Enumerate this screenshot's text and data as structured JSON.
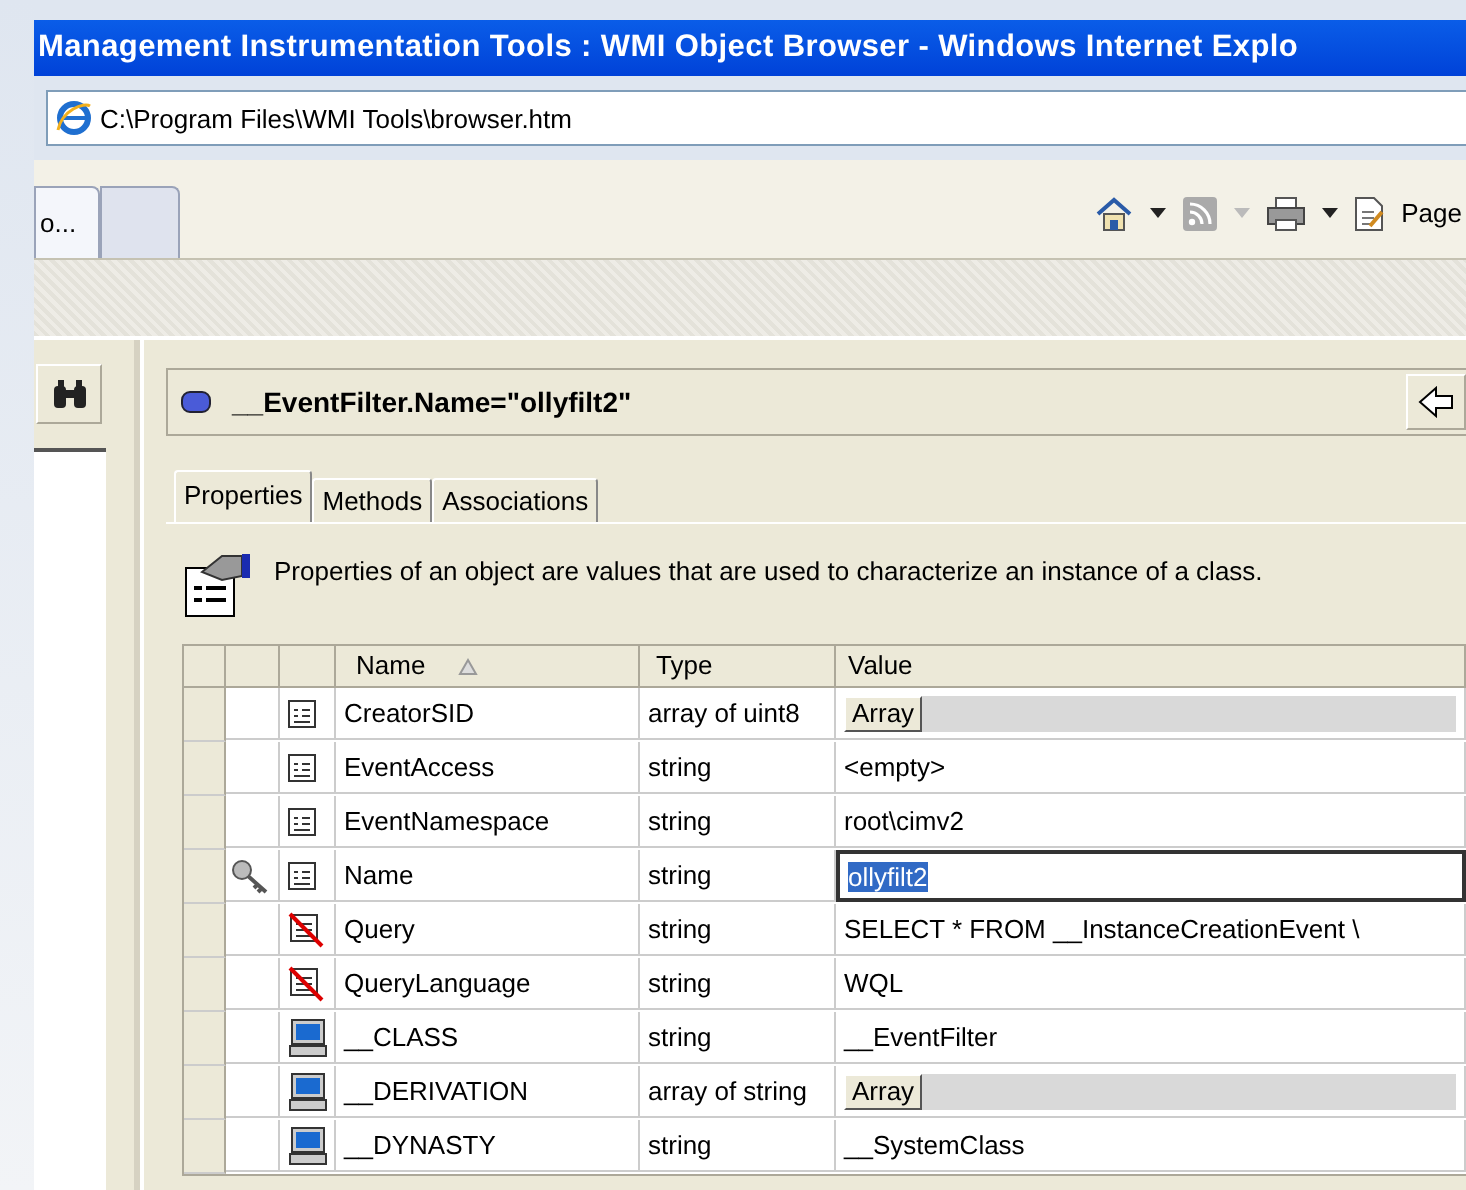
{
  "window": {
    "title": "Management Instrumentation Tools : WMI Object Browser - Windows Internet Explo"
  },
  "address_bar": {
    "value": "C:\\Program Files\\WMI Tools\\browser.htm"
  },
  "browser_tabs": [
    {
      "label": "o...",
      "selected": true
    },
    {
      "selected": false
    }
  ],
  "toolbar": {
    "page_label": "Page"
  },
  "object_path": "__EventFilter.Name=\"ollyfilt2\"",
  "tabs": [
    {
      "label": "Properties",
      "selected": true
    },
    {
      "label": "Methods",
      "selected": false
    },
    {
      "label": "Associations",
      "selected": false
    }
  ],
  "description": "Properties of an object are values that are used to characterize an instance of a class.",
  "table": {
    "columns": [
      "Name",
      "Type",
      "Value"
    ],
    "rows": [
      {
        "kind": "property",
        "key": false,
        "name": "CreatorSID",
        "type": "array of uint8",
        "value": {
          "kind": "array",
          "text": "Array"
        },
        "editing": false
      },
      {
        "kind": "property",
        "key": false,
        "name": "EventAccess",
        "type": "string",
        "value": {
          "kind": "text",
          "text": "<empty>"
        },
        "editing": false
      },
      {
        "kind": "property",
        "key": false,
        "name": "EventNamespace",
        "type": "string",
        "value": {
          "kind": "text",
          "text": "root\\cimv2"
        },
        "editing": false
      },
      {
        "kind": "property",
        "key": true,
        "name": "Name",
        "type": "string",
        "value": {
          "kind": "text",
          "text": "ollyfilt2"
        },
        "editing": true
      },
      {
        "kind": "restricted",
        "key": false,
        "name": "Query",
        "type": "string",
        "value": {
          "kind": "text",
          "text": "SELECT * FROM __InstanceCreationEvent \\"
        },
        "editing": false
      },
      {
        "kind": "restricted",
        "key": false,
        "name": "QueryLanguage",
        "type": "string",
        "value": {
          "kind": "text",
          "text": "WQL"
        },
        "editing": false
      },
      {
        "kind": "system",
        "key": false,
        "name": "__CLASS",
        "type": "string",
        "value": {
          "kind": "text",
          "text": "__EventFilter"
        },
        "editing": false
      },
      {
        "kind": "system",
        "key": false,
        "name": "__DERIVATION",
        "type": "array of string",
        "value": {
          "kind": "array",
          "text": "Array"
        },
        "editing": false
      },
      {
        "kind": "system",
        "key": false,
        "name": "__DYNASTY",
        "type": "string",
        "value": {
          "kind": "text",
          "text": "__SystemClass"
        },
        "editing": false
      }
    ]
  }
}
